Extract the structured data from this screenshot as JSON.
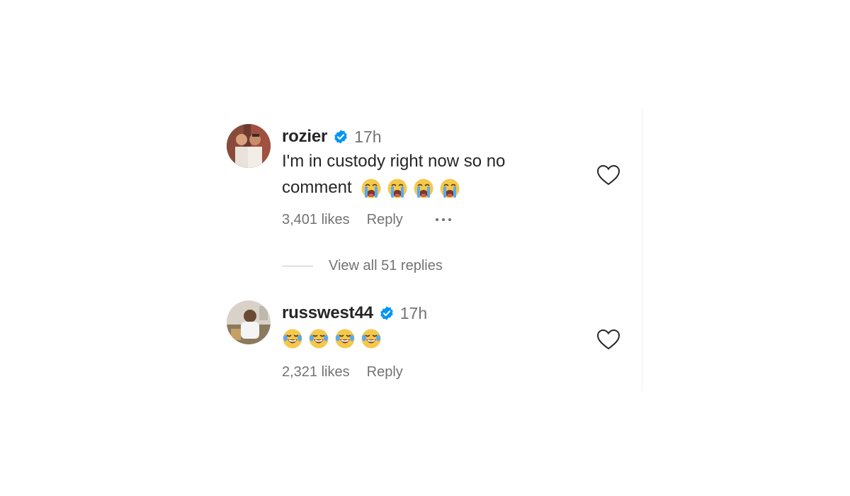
{
  "comments": [
    {
      "username": "rozier",
      "time": "17h",
      "text": "I'm in custody right now so no comment",
      "emojis": [
        "loudly-crying-face",
        "loudly-crying-face",
        "loudly-crying-face",
        "loudly-crying-face"
      ],
      "likes": "3,401 likes",
      "reply_label": "Reply",
      "view_replies": "View all 51 replies"
    },
    {
      "username": "russwest44",
      "time": "17h",
      "text": "",
      "emojis": [
        "face-with-tears-of-joy",
        "face-with-tears-of-joy",
        "face-with-tears-of-joy",
        "face-with-tears-of-joy"
      ],
      "likes": "2,321 likes",
      "reply_label": "Reply"
    }
  ],
  "colors": {
    "verified": "#0095f6",
    "secondary_text": "#737373",
    "primary_text": "#262626"
  },
  "icons": [
    "verified-badge-icon",
    "heart-icon",
    "more-options-icon"
  ]
}
